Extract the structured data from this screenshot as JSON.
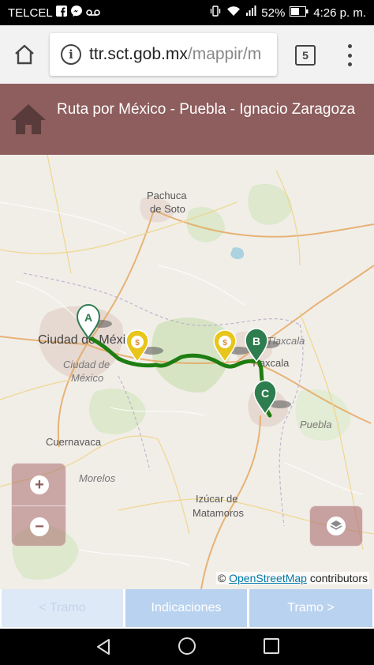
{
  "status_bar": {
    "carrier": "TELCEL",
    "battery": "52%",
    "time": "4:26 p. m."
  },
  "browser": {
    "url_domain": "ttr.sct.gob.mx",
    "url_path": "/mappir/m",
    "tab_count": "5"
  },
  "header": {
    "title": "Ruta por México - Puebla - Ignacio Zaragoza"
  },
  "map": {
    "labels": {
      "pachuca": "Pachuca",
      "de_soto": "de Soto",
      "ciudad_de_mexico": "Ciudad de México",
      "ciudad_de_mexico_italic_1": "Ciudad de",
      "ciudad_de_mexico_italic_2": "México",
      "tlaxcala": "Tlaxcala",
      "tlaxcala_city": "Tlaxcala",
      "puebla": "Puebla",
      "cuernavaca": "Cuernavaca",
      "morelos": "Morelos",
      "izucar_1": "Izúcar de",
      "izucar_2": "Matamoros"
    },
    "markers": {
      "a": "A",
      "b": "B",
      "c": "C"
    },
    "zoom_in": "+",
    "zoom_out": "−",
    "attribution_prefix": "©",
    "attribution_link": "OpenStreetMap",
    "attribution_suffix": "contributors",
    "colors": {
      "route": "#1e7d12",
      "marker": "#2e7d4f",
      "toll": "#e8c51a"
    }
  },
  "route_tabs": {
    "prev": "< Tramo",
    "indicaciones": "Indicaciones",
    "next": "Tramo >"
  }
}
